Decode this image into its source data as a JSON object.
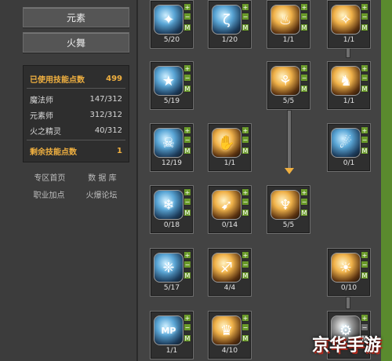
{
  "left": {
    "element_button": "元素",
    "skill_button": "火舞",
    "stats": {
      "used_label": "已使用技能点数",
      "used_value": "499",
      "rows": [
        {
          "name": "魔法师",
          "value": "147/312"
        },
        {
          "name": "元素师",
          "value": "312/312"
        },
        {
          "name": "火之精灵",
          "value": "40/312"
        }
      ],
      "remaining_label": "剩余技能点数",
      "remaining_value": "1"
    },
    "links": [
      "专区首页",
      "数 据 库",
      "职业加点",
      "火爆论坛"
    ]
  },
  "ctrl": {
    "plus": "+",
    "minus": "−",
    "max": "M"
  },
  "skills": [
    {
      "icon": "✦",
      "level": "5/20",
      "style": "ice"
    },
    {
      "icon": "ζ",
      "level": "1/20",
      "style": "ice"
    },
    {
      "icon": "♨",
      "level": "1/1",
      "style": "fire"
    },
    {
      "icon": "✧",
      "level": "1/1",
      "style": "fire"
    },
    {
      "icon": "★",
      "level": "5/19",
      "style": "ice"
    },
    {
      "icon": "⚘",
      "level": "5/5",
      "style": "fire"
    },
    {
      "icon": "♞",
      "level": "1/1",
      "style": "fire"
    },
    {
      "icon": "☠",
      "level": "12/19",
      "style": "ice"
    },
    {
      "icon": "✋",
      "level": "1/1",
      "style": "fire"
    },
    {
      "icon": "☄",
      "level": "0/1",
      "style": "ice"
    },
    {
      "icon": "❄",
      "level": "0/18",
      "style": "ice"
    },
    {
      "icon": "➹",
      "level": "0/14",
      "style": "fire"
    },
    {
      "icon": "♆",
      "level": "5/5",
      "style": "fire"
    },
    {
      "icon": "❈",
      "level": "5/17",
      "style": "ice"
    },
    {
      "icon": "♐",
      "level": "4/4",
      "style": "fire"
    },
    {
      "icon": "☀",
      "level": "0/10",
      "style": "fire"
    },
    {
      "icon": "MP",
      "level": "1/1",
      "style": "ice"
    },
    {
      "icon": "♛",
      "level": "4/10",
      "style": "fire"
    },
    {
      "icon": "⚙",
      "level": "",
      "style": "dark"
    }
  ],
  "watermark": "京华手游"
}
